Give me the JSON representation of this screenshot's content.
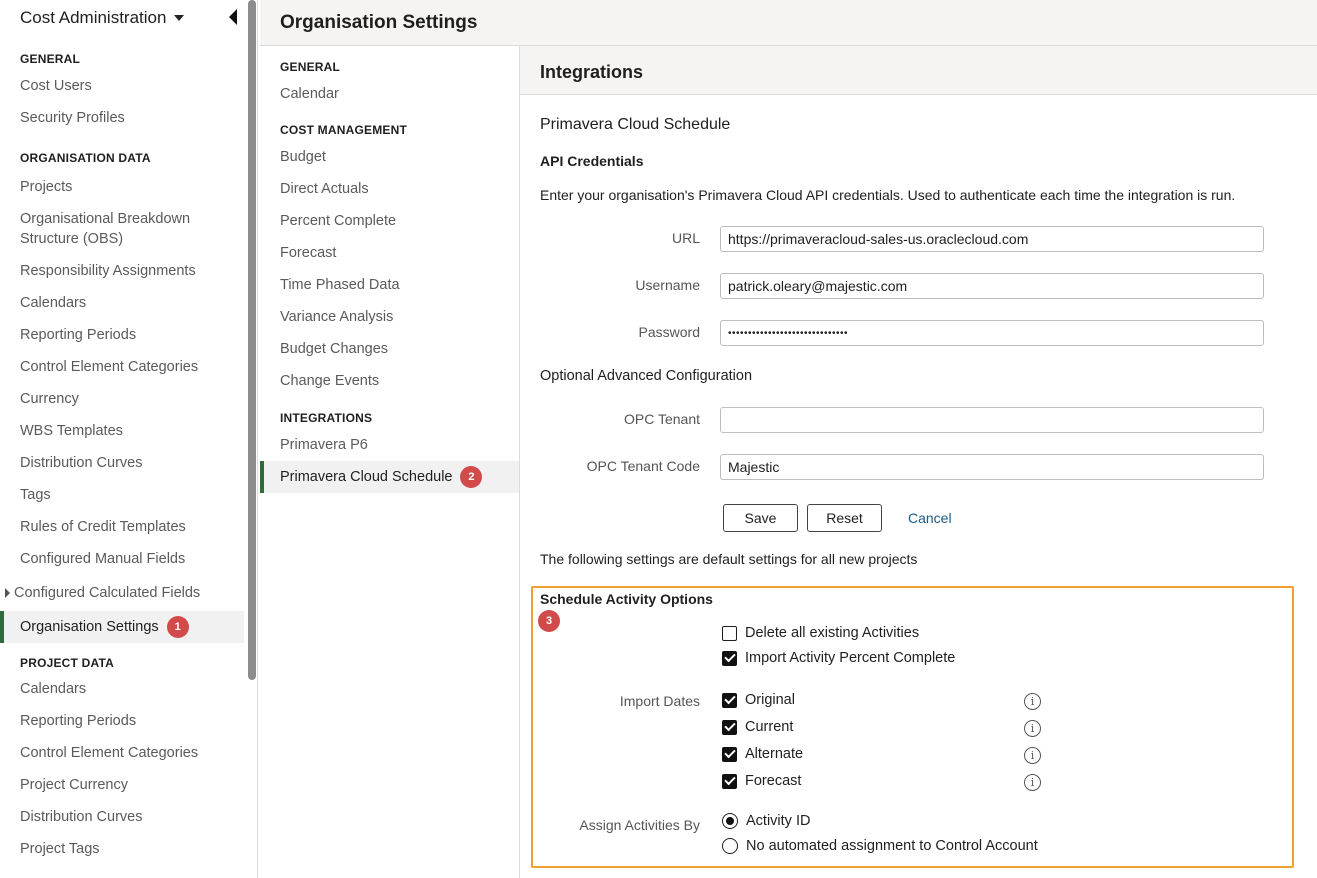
{
  "sidebar": {
    "app_title": "Cost Administration",
    "sections": [
      {
        "heading": "GENERAL",
        "items": [
          "Cost Users",
          "Security Profiles"
        ]
      },
      {
        "heading": "ORGANISATION DATA",
        "items": [
          "Projects",
          "Organisational Breakdown Structure (OBS)",
          "Responsibility Assignments",
          "Calendars",
          "Reporting Periods",
          "Control Element Categories",
          "Currency",
          "WBS Templates",
          "Distribution Curves",
          "Tags",
          "Rules of Credit Templates",
          "Configured Manual Fields",
          "Configured Calculated Fields",
          "Organisation Settings"
        ]
      },
      {
        "heading": "PROJECT DATA",
        "items": [
          "Calendars",
          "Reporting Periods",
          "Control Element Categories",
          "Project Currency",
          "Distribution Curves",
          "Project Tags"
        ]
      }
    ],
    "selected_badge": "1"
  },
  "header": {
    "title": "Organisation Settings"
  },
  "midnav": {
    "sections": [
      {
        "heading": "GENERAL",
        "items": [
          "Calendar"
        ]
      },
      {
        "heading": "COST MANAGEMENT",
        "items": [
          "Budget",
          "Direct Actuals",
          "Percent Complete",
          "Forecast",
          "Time Phased Data",
          "Variance Analysis",
          "Budget Changes",
          "Change Events"
        ]
      },
      {
        "heading": "INTEGRATIONS",
        "items": [
          "Primavera P6",
          "Primavera Cloud Schedule"
        ]
      }
    ],
    "selected_badge": "2"
  },
  "content": {
    "panel_title": "Integrations",
    "subtitle": "Primavera Cloud Schedule",
    "api_heading": "API Credentials",
    "api_desc": "Enter your organisation's Primavera Cloud API credentials. Used to authenticate each time the integration is run.",
    "url_label": "URL",
    "url_value": "https://primaveracloud-sales-us.oraclecloud.com",
    "username_label": "Username",
    "username_value": "patrick.oleary@majestic.com",
    "password_label": "Password",
    "password_value": "••••••••••••••••••••••••••••••",
    "advanced_heading": "Optional Advanced Configuration",
    "tenant_label": "OPC Tenant",
    "tenant_value": "",
    "tenant_code_label": "OPC Tenant Code",
    "tenant_code_value": "Majestic",
    "save_label": "Save",
    "reset_label": "Reset",
    "cancel_label": "Cancel",
    "defaults_note": "The following settings are default settings for all new projects",
    "schedule_heading": "Schedule Activity Options",
    "schedule_badge": "3",
    "delete_label": "Delete all existing Activities",
    "import_pct_label": "Import Activity Percent Complete",
    "import_dates_label": "Import Dates",
    "dates": [
      "Original",
      "Current",
      "Alternate",
      "Forecast"
    ],
    "assign_label": "Assign Activities By",
    "radio_activity_id": "Activity ID",
    "radio_none": "No automated assignment to Control Account"
  }
}
